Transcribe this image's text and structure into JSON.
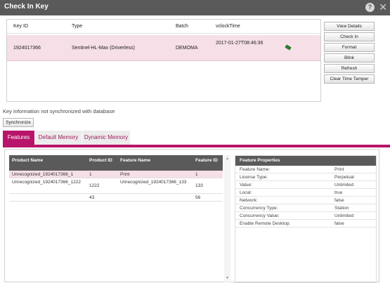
{
  "window": {
    "title": "Check In Key",
    "help": "?",
    "close": "✕"
  },
  "key_table": {
    "headers": {
      "key_id": "Key ID",
      "type": "Type",
      "batch": "Batch",
      "vclock_time": "vclockTime"
    },
    "rows": [
      {
        "key_id": "1924017366",
        "type": "Sentinel-HL-Max (Driverless)",
        "batch": "DEMOMA",
        "vclock_time": "2017-01-27T08:46:36",
        "icon": "key-icon"
      }
    ]
  },
  "actions": {
    "view_details": "View Details",
    "check_in": "Check In",
    "format": "Format",
    "blink": "Blink",
    "refresh": "Refresh",
    "clear_time_tamper": "Clear Time Tamper"
  },
  "sync": {
    "message": "Key information not synchronized with database",
    "button": "Synchronize"
  },
  "tabs": [
    {
      "label": "Features",
      "active": true
    },
    {
      "label": "Default Memory",
      "active": false
    },
    {
      "label": "Dynamic Memory",
      "active": false
    }
  ],
  "features_table": {
    "headers": {
      "product_name": "Product Name",
      "product_id": "Product ID",
      "feature_name": "Feature Name",
      "feature_id": "Feature ID"
    },
    "rows": [
      {
        "product_name": "Unrecognized_1924017366_1",
        "product_id": "1",
        "feature_name": "Print",
        "feature_id": "1"
      },
      {
        "product_name": "Unrecognized_1924017366_1222",
        "product_id": "1222",
        "feature_name": "Unrecognized_1924017366_133",
        "feature_id": "133"
      },
      {
        "product_name": "",
        "product_id": "43",
        "feature_name": "",
        "feature_id": "56"
      }
    ]
  },
  "feature_properties": {
    "title": "Feature Properties",
    "rows": [
      {
        "key": "Feature Name:",
        "value": "Print"
      },
      {
        "key": "License Type:",
        "value": "Perpetual"
      },
      {
        "key": "Value:",
        "value": "Unlimited"
      },
      {
        "key": "Local:",
        "value": "true"
      },
      {
        "key": "Network:",
        "value": "false"
      },
      {
        "key": "Concurrency Type:",
        "value": "Station"
      },
      {
        "key": "Concurrency Value:",
        "value": "Unlimited"
      },
      {
        "key": "Enable Remote Desktop:",
        "value": "false"
      }
    ]
  },
  "colors": {
    "accent": "#b8146a",
    "header_bg": "#5a5a5a",
    "selected_row": "#f6dfe6"
  }
}
